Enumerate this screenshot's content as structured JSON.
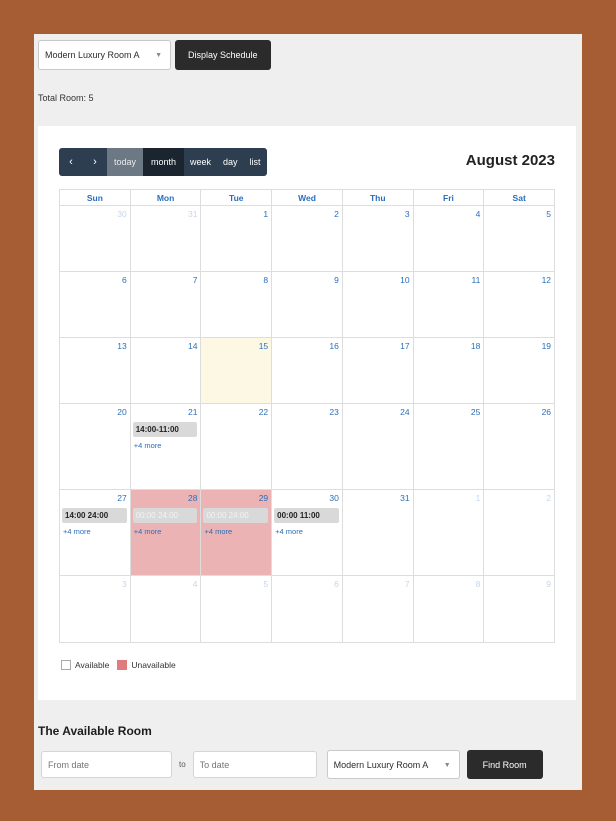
{
  "top": {
    "room_select": "Modern Luxury Room A",
    "display_button": "Display Schedule",
    "total_rooms": "Total Room: 5"
  },
  "calendar": {
    "toolbar": {
      "prev_icon": "‹",
      "next_icon": "›",
      "today": "today",
      "views": [
        "month",
        "week",
        "day",
        "list"
      ],
      "active_view": "month"
    },
    "title": "August 2023",
    "weekdays": [
      "Sun",
      "Mon",
      "Tue",
      "Wed",
      "Thu",
      "Fri",
      "Sat"
    ],
    "weeks": [
      [
        {
          "d": "30",
          "o": true
        },
        {
          "d": "31",
          "o": true
        },
        {
          "d": "1"
        },
        {
          "d": "2"
        },
        {
          "d": "3"
        },
        {
          "d": "4"
        },
        {
          "d": "5"
        }
      ],
      [
        {
          "d": "6"
        },
        {
          "d": "7"
        },
        {
          "d": "8"
        },
        {
          "d": "9"
        },
        {
          "d": "10"
        },
        {
          "d": "11"
        },
        {
          "d": "12"
        }
      ],
      [
        {
          "d": "13"
        },
        {
          "d": "14"
        },
        {
          "d": "15",
          "today": true
        },
        {
          "d": "16"
        },
        {
          "d": "17"
        },
        {
          "d": "18"
        },
        {
          "d": "19"
        }
      ],
      [
        {
          "d": "20"
        },
        {
          "d": "21",
          "event": "14:00-11:00",
          "more": "+4 more"
        },
        {
          "d": "22"
        },
        {
          "d": "23"
        },
        {
          "d": "24"
        },
        {
          "d": "25"
        },
        {
          "d": "26"
        }
      ],
      [
        {
          "d": "27",
          "event": "14:00 24:00",
          "more": "+4 more"
        },
        {
          "d": "28",
          "unavailable": true,
          "event": "00:00 24:00",
          "more": "+4 more"
        },
        {
          "d": "29",
          "unavailable": true,
          "event": "00:00 24:00",
          "more": "+4 more"
        },
        {
          "d": "30",
          "event": "00:00 11:00",
          "more": "+4 more"
        },
        {
          "d": "31"
        },
        {
          "d": "1",
          "o": true
        },
        {
          "d": "2",
          "o": true
        }
      ],
      [
        {
          "d": "3",
          "o": true
        },
        {
          "d": "4",
          "o": true
        },
        {
          "d": "5",
          "o": true
        },
        {
          "d": "6",
          "o": true
        },
        {
          "d": "7",
          "o": true
        },
        {
          "d": "8",
          "o": true
        },
        {
          "d": "9",
          "o": true
        }
      ]
    ],
    "legend": {
      "available": "Available",
      "unavailable": "Unavailable",
      "unavailable_color": "#e07c7e"
    }
  },
  "search": {
    "title": "The Available Room",
    "from_placeholder": "From date",
    "to_label": "to",
    "to_placeholder": "To date",
    "room_select": "Modern Luxury Room A",
    "find_button": "Find Room"
  }
}
